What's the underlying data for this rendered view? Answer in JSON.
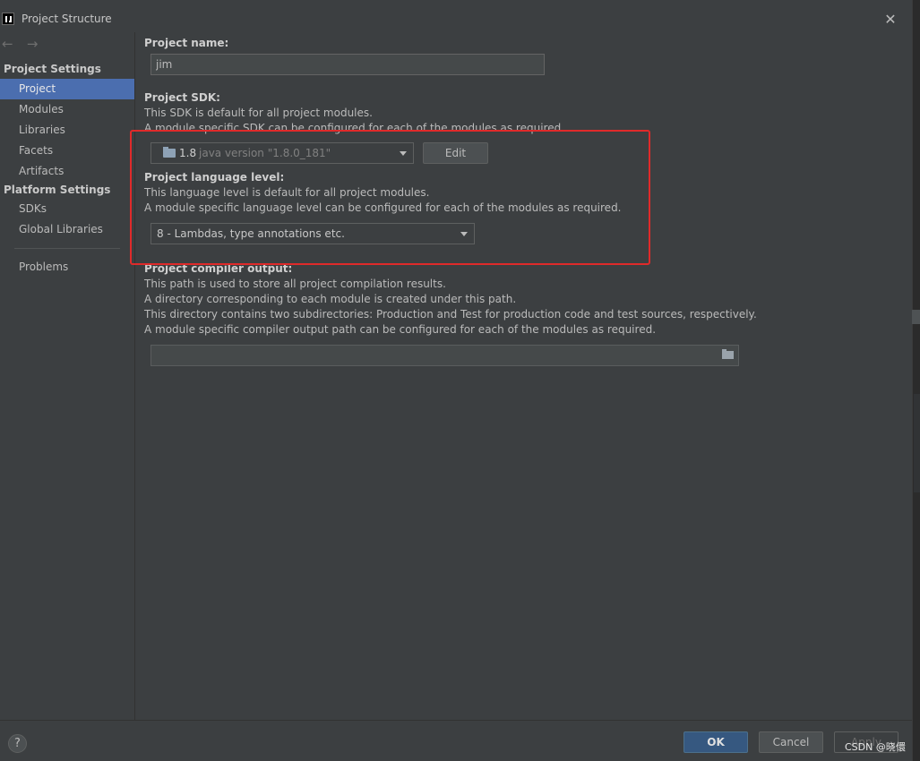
{
  "window": {
    "title": "Project Structure"
  },
  "sidebar": {
    "project_settings_header": "Project Settings",
    "project_items": [
      "Project",
      "Modules",
      "Libraries",
      "Facets",
      "Artifacts"
    ],
    "platform_settings_header": "Platform Settings",
    "platform_items": [
      "SDKs",
      "Global Libraries"
    ],
    "problems": "Problems",
    "selected": "Project"
  },
  "project_name": {
    "label": "Project name:",
    "value": "jim"
  },
  "project_sdk": {
    "label": "Project SDK:",
    "desc1": "This SDK is default for all project modules.",
    "desc2": "A module specific SDK can be configured for each of the modules as required.",
    "selected_version": "1.8",
    "selected_detail": "java version \"1.8.0_181\"",
    "edit_button": "Edit"
  },
  "language_level": {
    "label": "Project language level:",
    "desc1": "This language level is default for all project modules.",
    "desc2": "A module specific language level can be configured for each of the modules as required.",
    "selected": "8 - Lambdas, type annotations etc."
  },
  "compiler_output": {
    "label": "Project compiler output:",
    "desc1": "This path is used to store all project compilation results.",
    "desc2": "A directory corresponding to each module is created under this path.",
    "desc3": "This directory contains two subdirectories: Production and Test for production code and test sources, respectively.",
    "desc4": "A module specific compiler output path can be configured for each of the modules as required.",
    "value": ""
  },
  "buttons": {
    "help": "?",
    "ok": "OK",
    "cancel": "Cancel",
    "apply": "Apply"
  },
  "watermark": "CSDN @晓儇",
  "colors": {
    "highlight": "#e02a2a",
    "selection": "#4b6eaf",
    "ok_button": "#365880"
  }
}
